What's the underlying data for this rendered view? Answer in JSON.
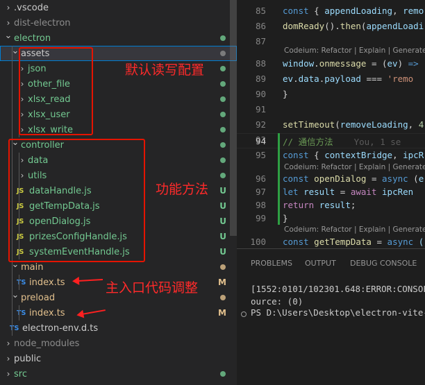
{
  "explorer": {
    "items": [
      {
        "label": ".vscode",
        "kind": "folder",
        "expanded": false,
        "level": 0,
        "color": "#cccccc"
      },
      {
        "label": "dist-electron",
        "kind": "folder",
        "expanded": false,
        "level": 0,
        "color": "#8c8c8c"
      },
      {
        "label": "electron",
        "kind": "folder",
        "expanded": true,
        "level": 0,
        "color": "#73c991",
        "dot": true
      },
      {
        "label": "assets",
        "kind": "folder",
        "expanded": true,
        "level": 1,
        "color": "#cccccc",
        "selected": true,
        "dot": true,
        "dotGray": true
      },
      {
        "label": "json",
        "kind": "folder",
        "expanded": false,
        "level": 2,
        "color": "#73c991",
        "dot": true
      },
      {
        "label": "other_file",
        "kind": "folder",
        "expanded": false,
        "level": 2,
        "color": "#73c991",
        "dot": true
      },
      {
        "label": "xlsx_read",
        "kind": "folder",
        "expanded": false,
        "level": 2,
        "color": "#73c991",
        "dot": true
      },
      {
        "label": "xlsx_user",
        "kind": "folder",
        "expanded": false,
        "level": 2,
        "color": "#73c991",
        "dot": true
      },
      {
        "label": "xlsx_write",
        "kind": "folder",
        "expanded": false,
        "level": 2,
        "color": "#73c991",
        "dot": true
      },
      {
        "label": "controller",
        "kind": "folder",
        "expanded": true,
        "level": 1,
        "color": "#73c991",
        "dot": true
      },
      {
        "label": "data",
        "kind": "folder",
        "expanded": false,
        "level": 2,
        "color": "#73c991",
        "dot": true
      },
      {
        "label": "utils",
        "kind": "folder",
        "expanded": false,
        "level": 2,
        "color": "#73c991",
        "dot": true
      },
      {
        "label": "dataHandle.js",
        "kind": "js",
        "level": 2,
        "color": "#73c991",
        "badge": "U"
      },
      {
        "label": "getTempData.js",
        "kind": "js",
        "level": 2,
        "color": "#73c991",
        "badge": "U"
      },
      {
        "label": "openDialog.js",
        "kind": "js",
        "level": 2,
        "color": "#73c991",
        "badge": "U"
      },
      {
        "label": "prizesConfigHandle.js",
        "kind": "js",
        "level": 2,
        "color": "#73c991",
        "badge": "U"
      },
      {
        "label": "systemEventHandle.js",
        "kind": "js",
        "level": 2,
        "color": "#73c991",
        "badge": "U"
      },
      {
        "label": "main",
        "kind": "folder",
        "expanded": true,
        "level": 1,
        "color": "#e2c08d",
        "dot": true,
        "dotColor": "#e2c08d"
      },
      {
        "label": "index.ts",
        "kind": "ts",
        "level": 2,
        "color": "#e2c08d",
        "badge": "M"
      },
      {
        "label": "preload",
        "kind": "folder",
        "expanded": true,
        "level": 1,
        "color": "#e2c08d",
        "dot": true,
        "dotColor": "#e2c08d"
      },
      {
        "label": "index.ts",
        "kind": "ts",
        "level": 2,
        "color": "#e2c08d",
        "badge": "M"
      },
      {
        "label": "electron-env.d.ts",
        "kind": "ts",
        "level": 1,
        "color": "#cccccc"
      },
      {
        "label": "node_modules",
        "kind": "folder",
        "expanded": false,
        "level": 0,
        "color": "#8c8c8c"
      },
      {
        "label": "public",
        "kind": "folder",
        "expanded": false,
        "level": 0,
        "color": "#cccccc"
      },
      {
        "label": "src",
        "kind": "folder",
        "expanded": false,
        "level": 0,
        "color": "#73c991",
        "dot": true
      }
    ],
    "badge_color_U": "#73c991",
    "badge_color_M": "#e2c08d"
  },
  "annotations": {
    "assets_note": "默认读写配置",
    "controller_note": "功能方法",
    "main_note": "主入口代码调整"
  },
  "editor": {
    "lens_text": "Codeium: Refactor | Explain | Generate",
    "blame_text": "You, 1 se"
  },
  "panel": {
    "tabs": [
      "PROBLEMS",
      "OUTPUT",
      "DEBUG CONSOLE"
    ],
    "lines": [
      "[1552:0101/102301.648:ERROR:CONSOLE(",
      "ource:  (0)",
      "PS D:\\Users\\Desktop\\electron-vite-vu"
    ]
  }
}
